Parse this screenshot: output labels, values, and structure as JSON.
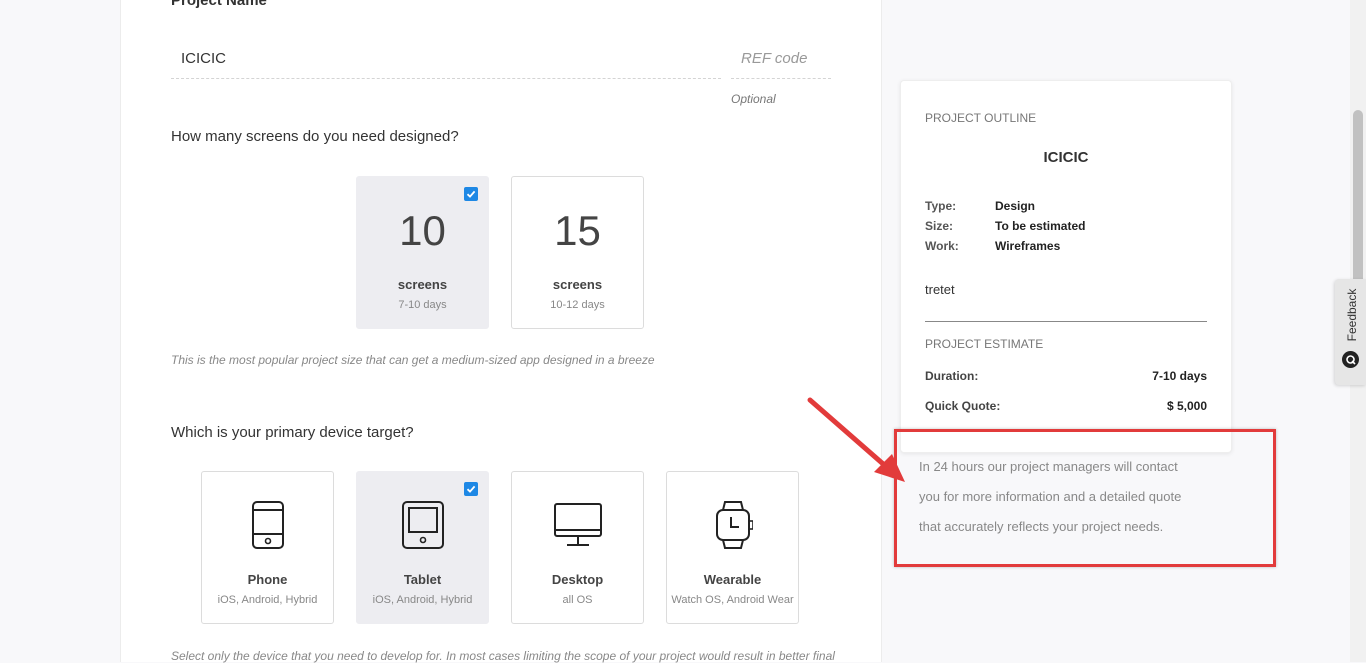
{
  "project": {
    "name_label": "Project Name",
    "name_value": "ICICIC",
    "ref_placeholder": "REF code",
    "optional_text": "Optional"
  },
  "screens": {
    "question": "How many screens do you need designed?",
    "options": [
      {
        "count": "10",
        "label": "screens",
        "duration": "7-10 days",
        "selected": true
      },
      {
        "count": "15",
        "label": "screens",
        "duration": "10-12 days",
        "selected": false
      }
    ],
    "hint": "This is the most popular project size that can get a medium-sized app designed in a breeze"
  },
  "devices": {
    "question": "Which is your primary device target?",
    "options": [
      {
        "icon": "phone-icon",
        "label": "Phone",
        "sub": "iOS, Android, Hybrid",
        "selected": false
      },
      {
        "icon": "tablet-icon",
        "label": "Tablet",
        "sub": "iOS, Android, Hybrid",
        "selected": true
      },
      {
        "icon": "desktop-icon",
        "label": "Desktop",
        "sub": "all OS",
        "selected": false
      },
      {
        "icon": "watch-icon",
        "label": "Wearable",
        "sub": "Watch OS, Android Wear",
        "selected": false
      }
    ],
    "hint": "Select only the device that you need to develop for. In most cases limiting the scope of your project would result in better final"
  },
  "outline": {
    "heading": "PROJECT OUTLINE",
    "title": "ICICIC",
    "type_key": "Type:",
    "type_val": "Design",
    "size_key": "Size:",
    "size_val": "To be estimated",
    "work_key": "Work:",
    "work_val": "Wireframes",
    "note": "tretet",
    "estimate_heading": "PROJECT ESTIMATE",
    "duration_key": "Duration:",
    "duration_val": "7-10 days",
    "quote_key": "Quick Quote:",
    "quote_val": "$ 5,000"
  },
  "contact": {
    "line1": "In 24 hours our project managers will contact",
    "line2": "you for more information and a detailed quote",
    "line3": "that accurately reflects your project needs."
  },
  "feedback": {
    "label": "Feedback"
  },
  "colors": {
    "accent": "#1e88e5",
    "selected_card": "#ededf1",
    "annotation_red": "#e23b3b"
  }
}
